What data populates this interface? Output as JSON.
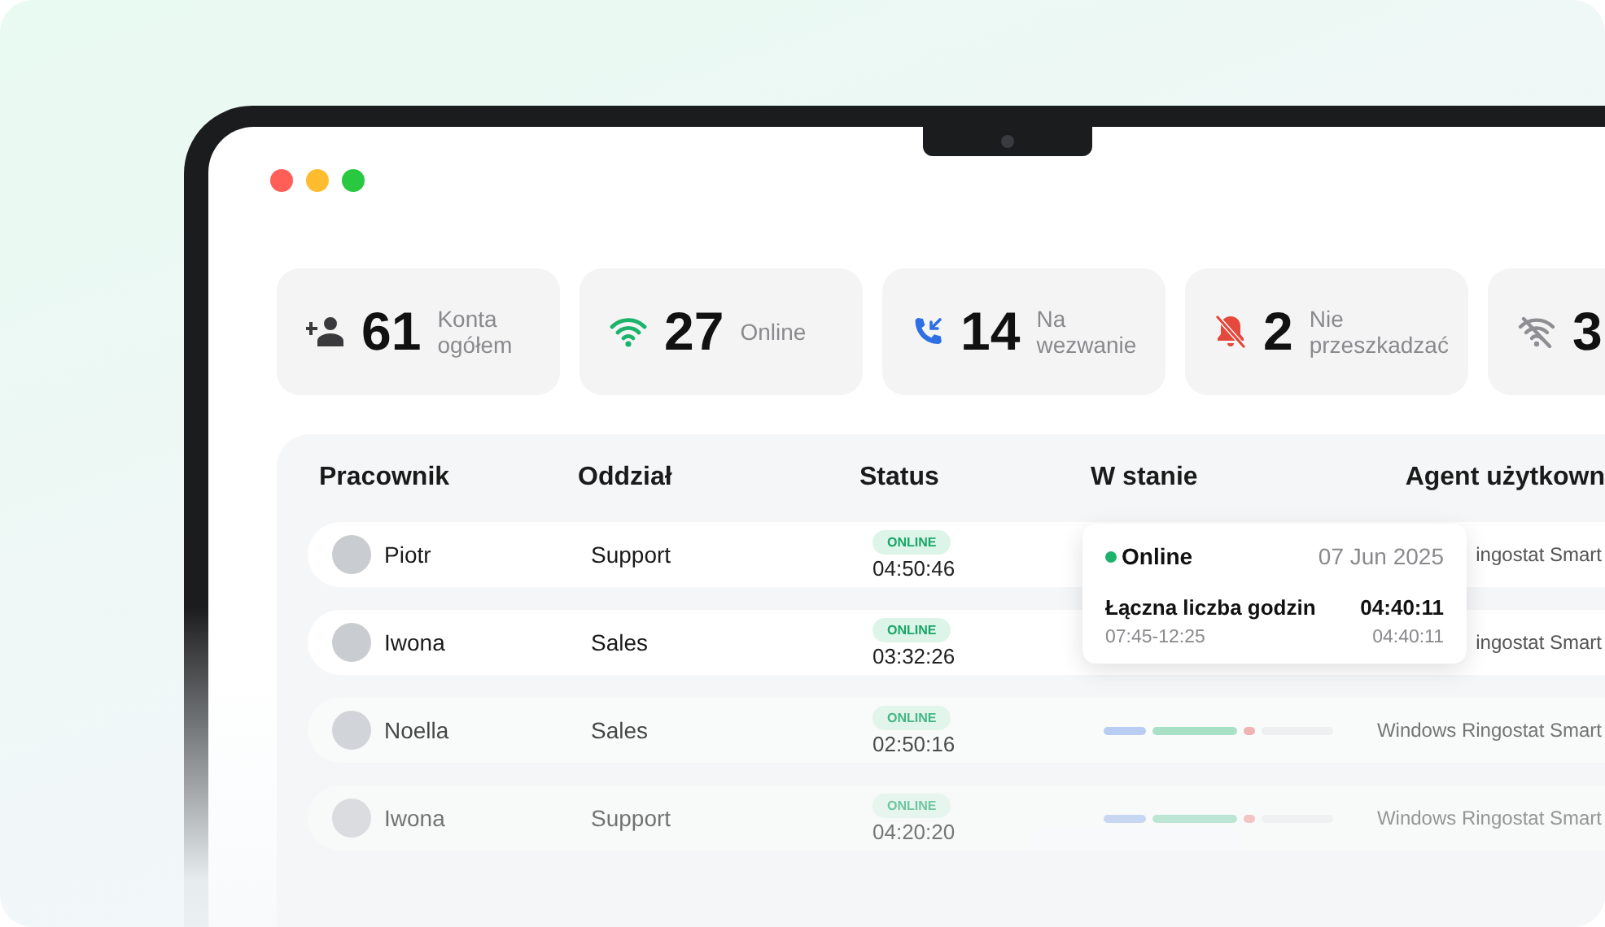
{
  "stats": [
    {
      "value": "61",
      "label": "Konta ogółem"
    },
    {
      "value": "27",
      "label": "Online"
    },
    {
      "value": "14",
      "label": "Na wezwanie"
    },
    {
      "value": "2",
      "label": "Nie przeszkadzać"
    },
    {
      "value": "3"
    }
  ],
  "table": {
    "columns": [
      "Pracownik",
      "Oddział",
      "Status",
      "W stanie",
      "Agent użytkown"
    ],
    "rows": [
      {
        "name": "Piotr",
        "department": "Support",
        "badge": "ONLINE",
        "time": "04:50:46",
        "agent": "ingostat Smart"
      },
      {
        "name": "Iwona",
        "department": "Sales",
        "badge": "ONLINE",
        "time": "03:32:26",
        "agent": "ingostat Smart"
      },
      {
        "name": "Noella",
        "department": "Sales",
        "badge": "ONLINE",
        "time": "02:50:16",
        "agent": "Windows Ringostat Smart"
      },
      {
        "name": "Iwona",
        "department": "Support",
        "badge": "ONLINE",
        "time": "04:20:20",
        "agent": "Windows Ringostat Smart"
      }
    ]
  },
  "tooltip": {
    "status": "Online",
    "date": "07 Jun 2025",
    "total_label": "Łączna liczba godzin",
    "total_value": "04:40:11",
    "range": "07:45-12:25",
    "range_value": "04:40:11"
  }
}
